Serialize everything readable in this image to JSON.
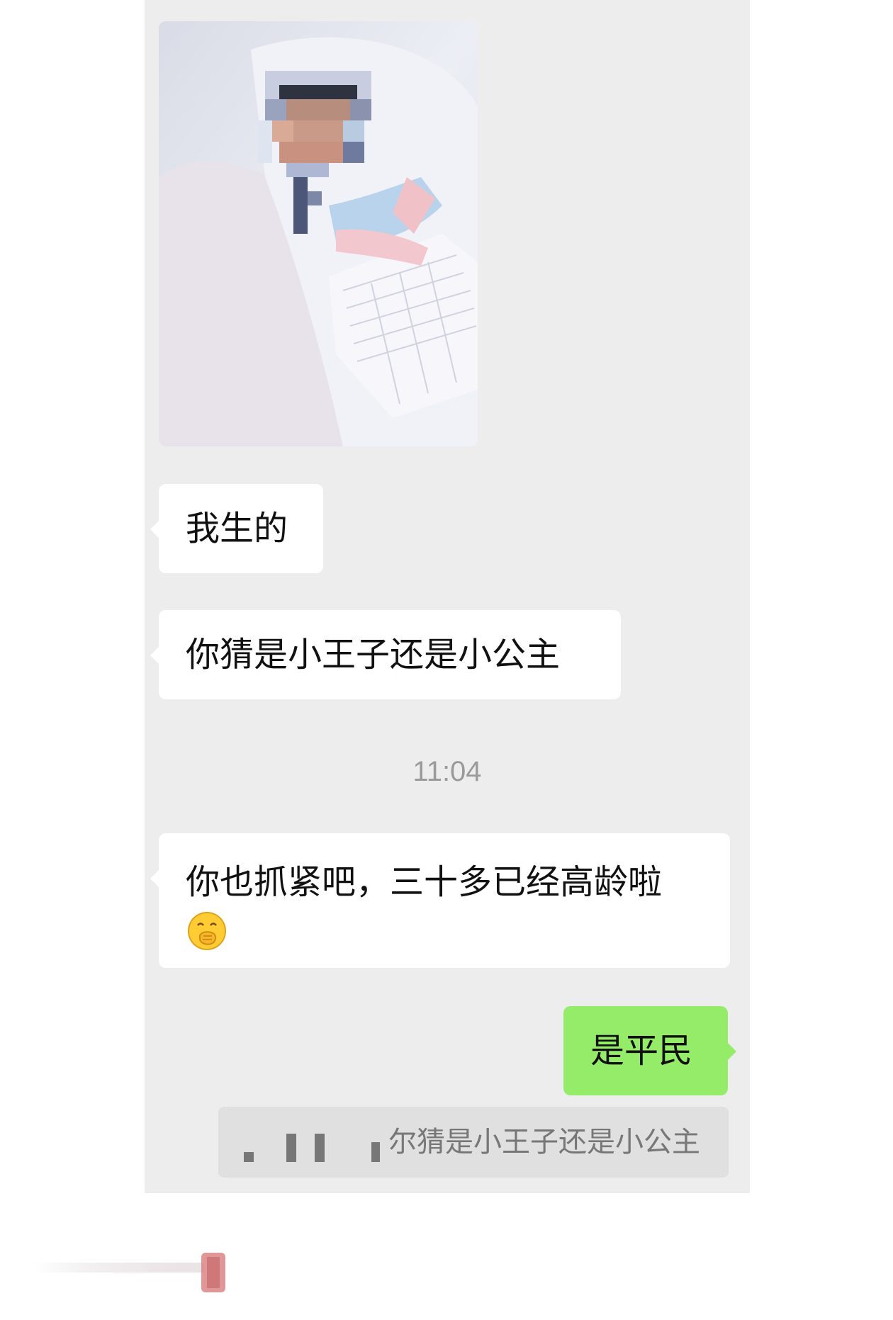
{
  "chat": {
    "messages": [
      {
        "type": "image",
        "side": "left",
        "alt": ""
      },
      {
        "type": "text",
        "side": "left",
        "text": "我生的"
      },
      {
        "type": "text",
        "side": "left",
        "text": "你猜是小王子还是小公主"
      },
      {
        "type": "time",
        "text": "11:04"
      },
      {
        "type": "text",
        "side": "left",
        "text": "你也抓紧吧，三十多已经高龄啦",
        "emoji": "face-with-hand-over-mouth-icon"
      },
      {
        "type": "text",
        "side": "right",
        "text": "是平民"
      }
    ],
    "quote": {
      "text": "尔猜是小王子还是小公主"
    }
  },
  "colors": {
    "chat_background": "#ededed",
    "incoming_bubble": "#ffffff",
    "outgoing_bubble": "#95ec69",
    "timestamp_text": "#9a9a9a",
    "quote_background": "#e0e0e0"
  }
}
